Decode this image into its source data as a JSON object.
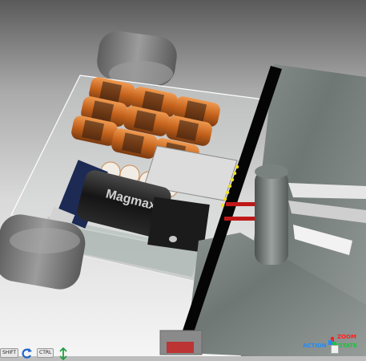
{
  "viewer": {
    "battery_brand": "Magmax",
    "controls": {
      "shift_key": "SHIFT",
      "ctrl_key": "CTRL"
    },
    "gizmo": {
      "zoom_label": "ZOOM",
      "action_label": "ACTION",
      "rotate_label": "ROTATE"
    }
  },
  "colors": {
    "zoom": "#ff2020",
    "action": "#1e8cff",
    "rotate": "#20c040"
  }
}
